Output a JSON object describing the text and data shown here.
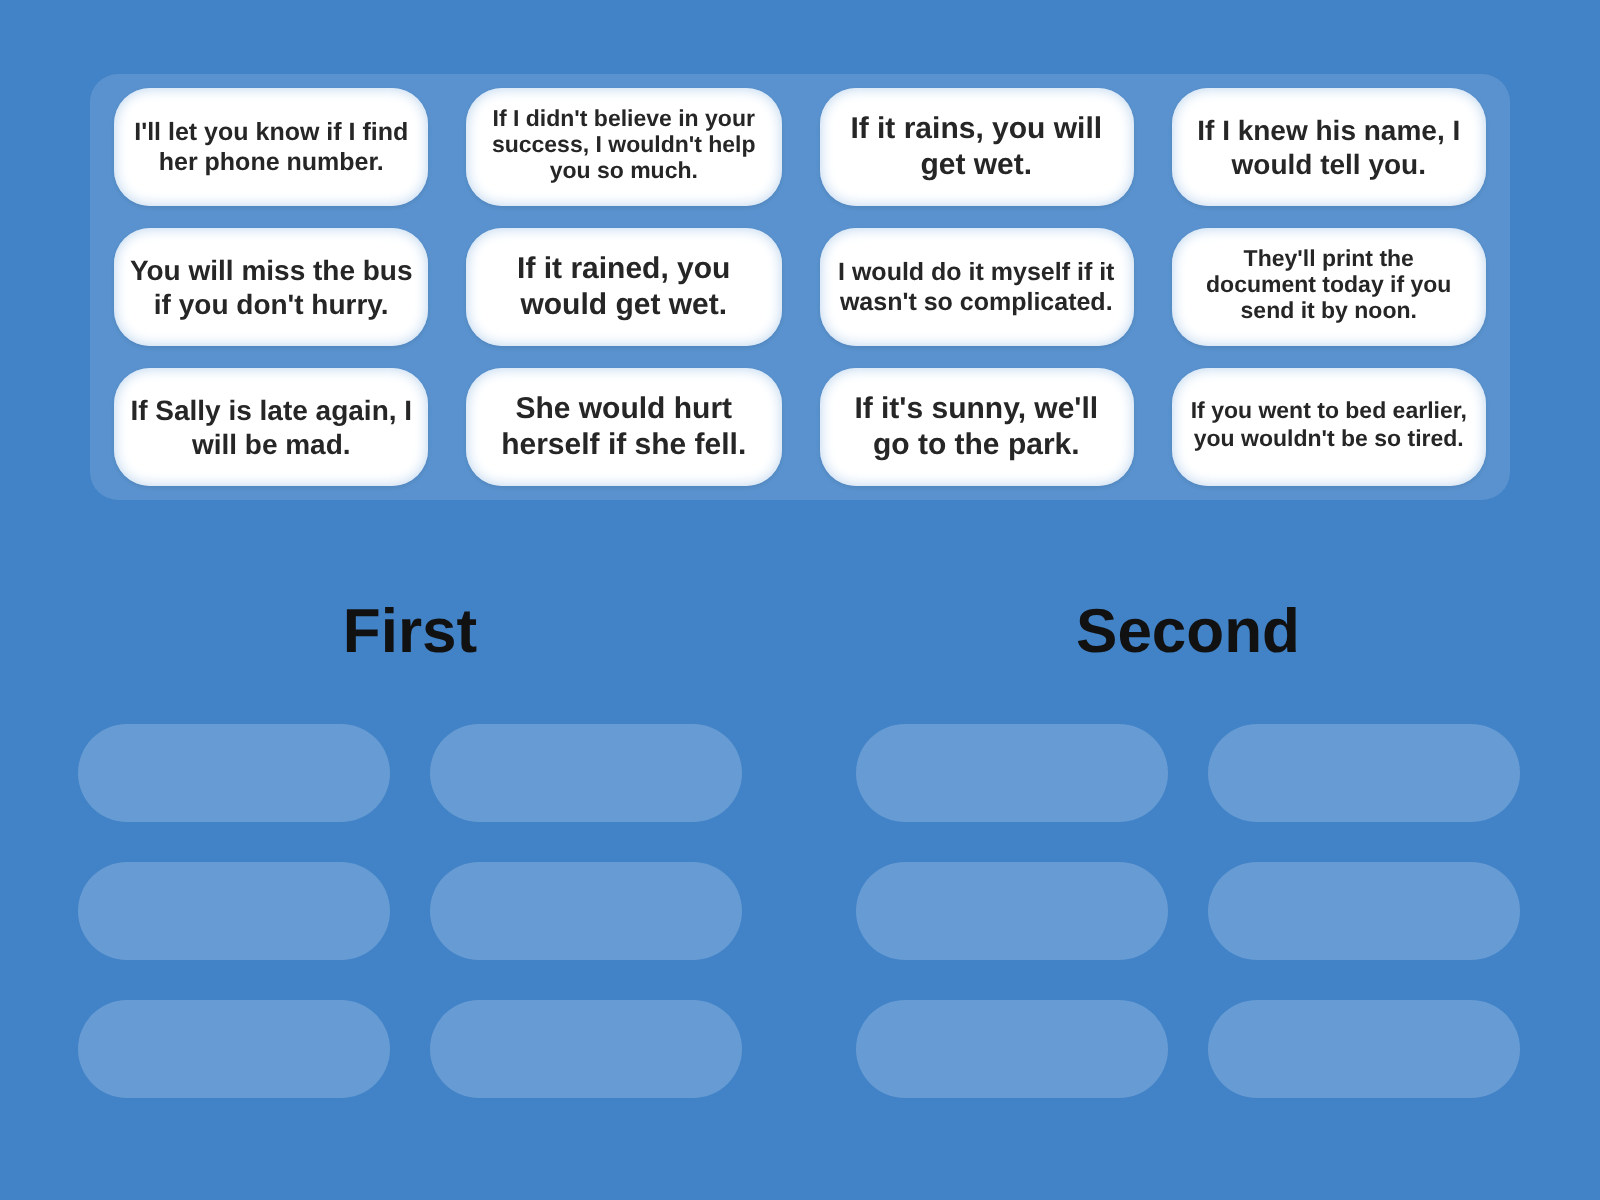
{
  "cards": [
    {
      "text": "I'll let you know if I find her phone number."
    },
    {
      "text": "If I didn't believe in your success, I wouldn't help you so much."
    },
    {
      "text": "If it rains, you will get wet."
    },
    {
      "text": "If I knew his name, I would tell you."
    },
    {
      "text": "You will miss the bus if you don't hurry."
    },
    {
      "text": "If it rained, you would get wet."
    },
    {
      "text": "I would do it myself if it wasn't so complicated."
    },
    {
      "text": "They'll print the document today if you send it by noon."
    },
    {
      "text": "If Sally is late again, I will be mad."
    },
    {
      "text": "She would hurt herself if she fell."
    },
    {
      "text": "If it's sunny, we'll go to the park."
    },
    {
      "text": "If you went to bed earlier, you wouldn't be so tired."
    }
  ],
  "groups": [
    {
      "title": "First"
    },
    {
      "title": "Second"
    }
  ]
}
